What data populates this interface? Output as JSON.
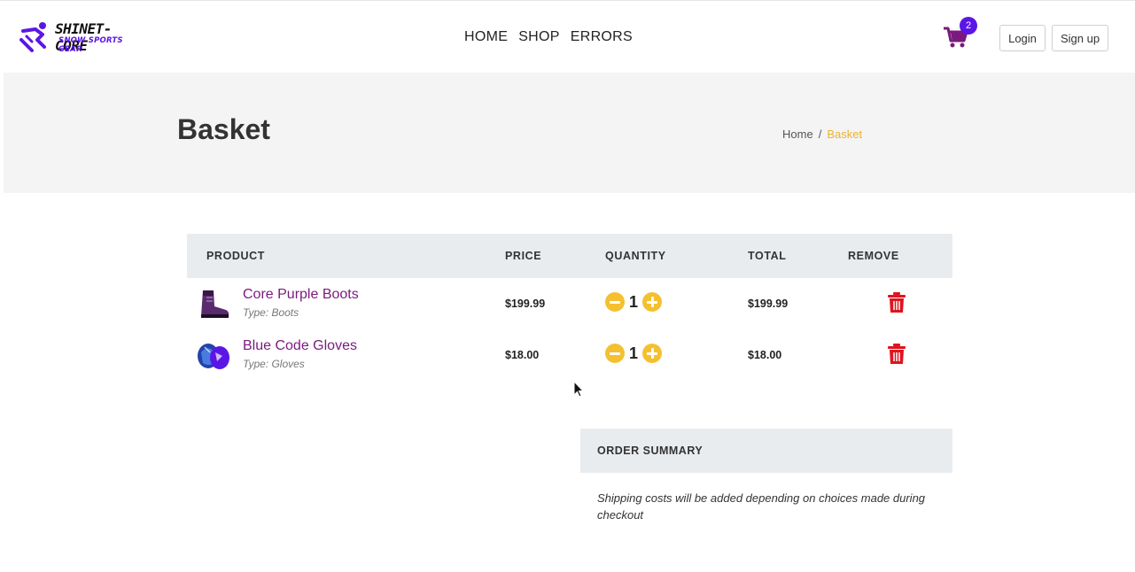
{
  "header": {
    "logo": {
      "title": "SHINET-CORE",
      "subtitle": "SNOW SPORTS GEAR"
    },
    "nav": [
      {
        "label": "HOME"
      },
      {
        "label": "SHOP"
      },
      {
        "label": "ERRORS"
      }
    ],
    "cart": {
      "icon": "cart-icon",
      "count": "2",
      "color": "#7a1a7e",
      "badge_color": "#5b16e6"
    },
    "login_label": "Login",
    "signup_label": "Sign up"
  },
  "hero": {
    "title": "Basket",
    "breadcrumb": {
      "home": "Home",
      "separator": "/",
      "current": "Basket"
    }
  },
  "table": {
    "headers": {
      "product": "PRODUCT",
      "price": "PRICE",
      "quantity": "QUANTITY",
      "total": "TOTAL",
      "remove": "REMOVE"
    },
    "rows": [
      {
        "name": "Core Purple Boots",
        "type": "Type: Boots",
        "price": "$199.99",
        "quantity": "1",
        "total": "$199.99",
        "thumb_icon": "boot-icon"
      },
      {
        "name": "Blue Code Gloves",
        "type": "Type: Gloves",
        "price": "$18.00",
        "quantity": "1",
        "total": "$18.00",
        "thumb_icon": "gloves-icon"
      }
    ]
  },
  "summary": {
    "title": "ORDER SUMMARY",
    "note": "Shipping costs will be added depending on choices made during checkout"
  },
  "colors": {
    "accent": "#f0b22c",
    "product_link": "#7a1a7e",
    "remove": "#e0141e",
    "quantity_button": "#f5c030"
  }
}
